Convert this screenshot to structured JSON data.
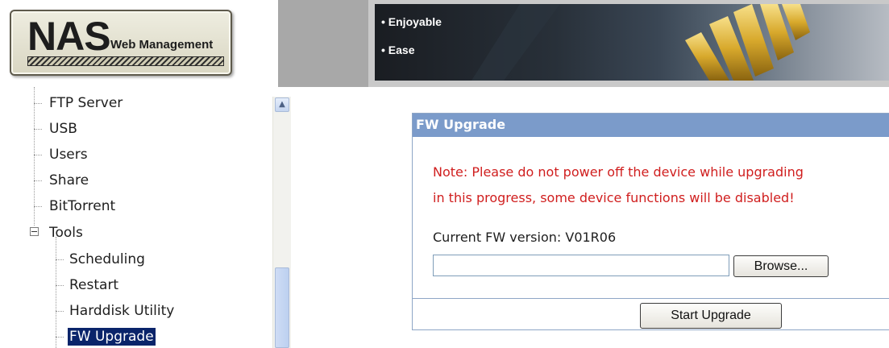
{
  "header": {
    "logo_title": "NAS",
    "logo_subtitle": "Web Management",
    "banner_bullets": [
      "• Enjoyable",
      "• Ease"
    ]
  },
  "sidebar": {
    "items": [
      {
        "label": "FTP Server",
        "level": 1
      },
      {
        "label": "USB",
        "level": 1
      },
      {
        "label": "Users",
        "level": 1
      },
      {
        "label": "Share",
        "level": 1
      },
      {
        "label": "BitTorrent",
        "level": 1
      },
      {
        "label": "Tools",
        "level": 0,
        "expanded": true
      },
      {
        "label": "Scheduling",
        "level": 2
      },
      {
        "label": "Restart",
        "level": 2
      },
      {
        "label": "Harddisk Utility",
        "level": 2
      },
      {
        "label": "FW Upgrade",
        "level": 2,
        "selected": true
      }
    ],
    "expander_symbol": "−",
    "scroll_up_symbol": "▲"
  },
  "panel": {
    "title": "FW Upgrade",
    "note_line1": "Note: Please do not power off the device while upgrading",
    "note_line2": "in this progress, some device functions will be disabled!",
    "fw_version_label": "Current FW version: V01R06",
    "file_value": "",
    "browse_label": "Browse...",
    "start_upgrade_label": "Start Upgrade"
  },
  "colors": {
    "panel_header": "#7b9bca",
    "note_text": "#d01e1e",
    "selection": "#0a246a"
  }
}
